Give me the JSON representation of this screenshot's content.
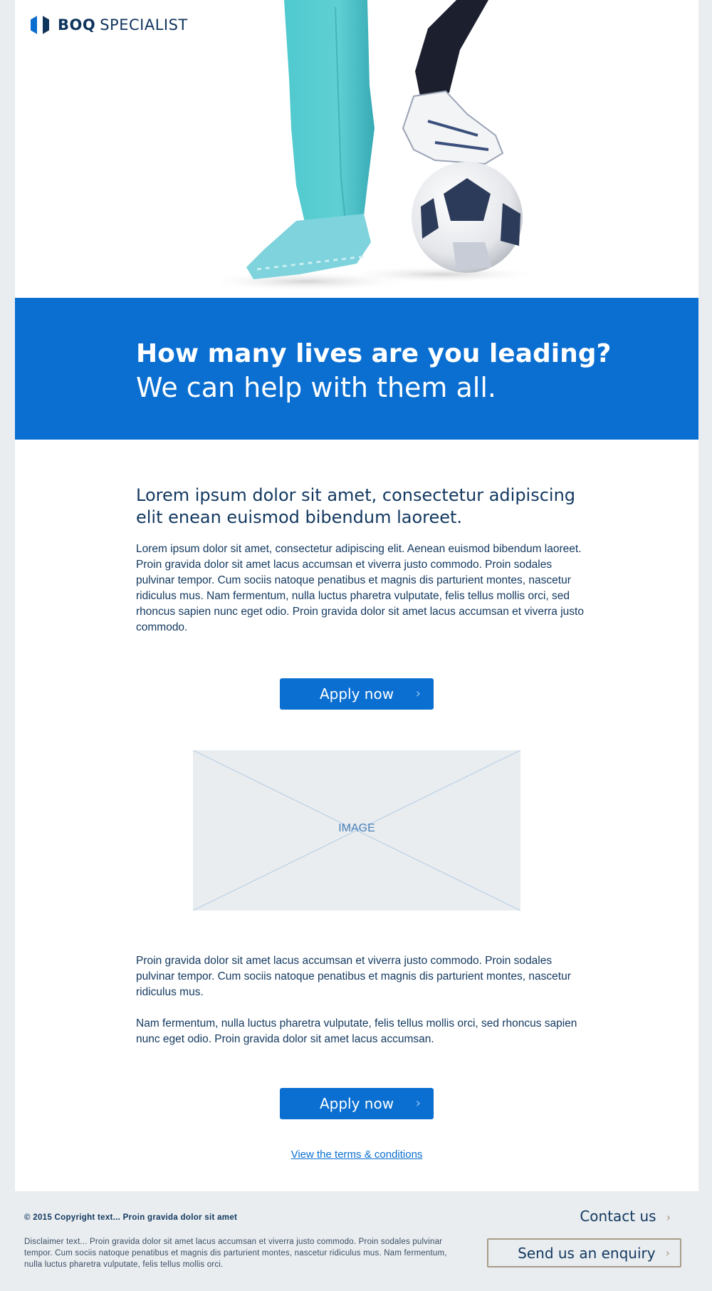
{
  "brand": {
    "bold": "BOQ",
    "regular": "SPECIALIST"
  },
  "banner": {
    "headline": "How many lives are you leading?",
    "subheadline": "We can help with them all."
  },
  "content": {
    "intro": "Lorem ipsum dolor sit amet, consectetur adipiscing elit enean euismod bibendum laoreet.",
    "paragraph1": "Lorem ipsum dolor sit amet, consectetur adipiscing elit. Aenean euismod bibendum laoreet. Proin gravida dolor sit amet lacus accumsan et viverra justo commodo. Proin sodales pulvinar tempor. Cum sociis natoque penatibus et magnis dis parturient montes, nascetur ridiculus mus. Nam fermentum, nulla luctus pharetra vulputate, felis tellus mollis orci, sed rhoncus sapien nunc eget odio. Proin gravida dolor sit amet lacus accumsan et viverra justo commodo.",
    "apply_label": "Apply now",
    "image_label": "IMAGE",
    "paragraph2": "Proin gravida dolor sit amet lacus accumsan et viverra justo commodo. Proin sodales pulvinar tempor. Cum sociis natoque penatibus et magnis dis parturient montes, nascetur ridiculus mus.",
    "paragraph3": "Nam fermentum, nulla luctus pharetra vulputate, felis tellus mollis orci, sed rhoncus sapien nunc eget odio. Proin gravida dolor sit amet lacus accumsan.",
    "terms_link": "View the terms & conditions"
  },
  "footer": {
    "copyright": "© 2015 Copyright text... Proin gravida dolor sit amet",
    "disclaimer": "Disclaimer text... Proin gravida dolor sit amet lacus accumsan et viverra justo commodo. Proin sodales pulvinar tempor. Cum sociis natoque penatibus et magnis dis parturient montes, nascetur ridiculus mus. Nam fermentum, nulla luctus pharetra vulputate, felis tellus mollis orci.",
    "contact_label": "Contact us",
    "enquiry_label": "Send us an enquiry"
  },
  "icons": {
    "button_chevron": "chevron-right-icon"
  },
  "colors": {
    "brand_blue": "#0a6fd1",
    "navy": "#12385f",
    "footer_bg": "#e9edf0",
    "accent_orange": "#f08a24"
  }
}
